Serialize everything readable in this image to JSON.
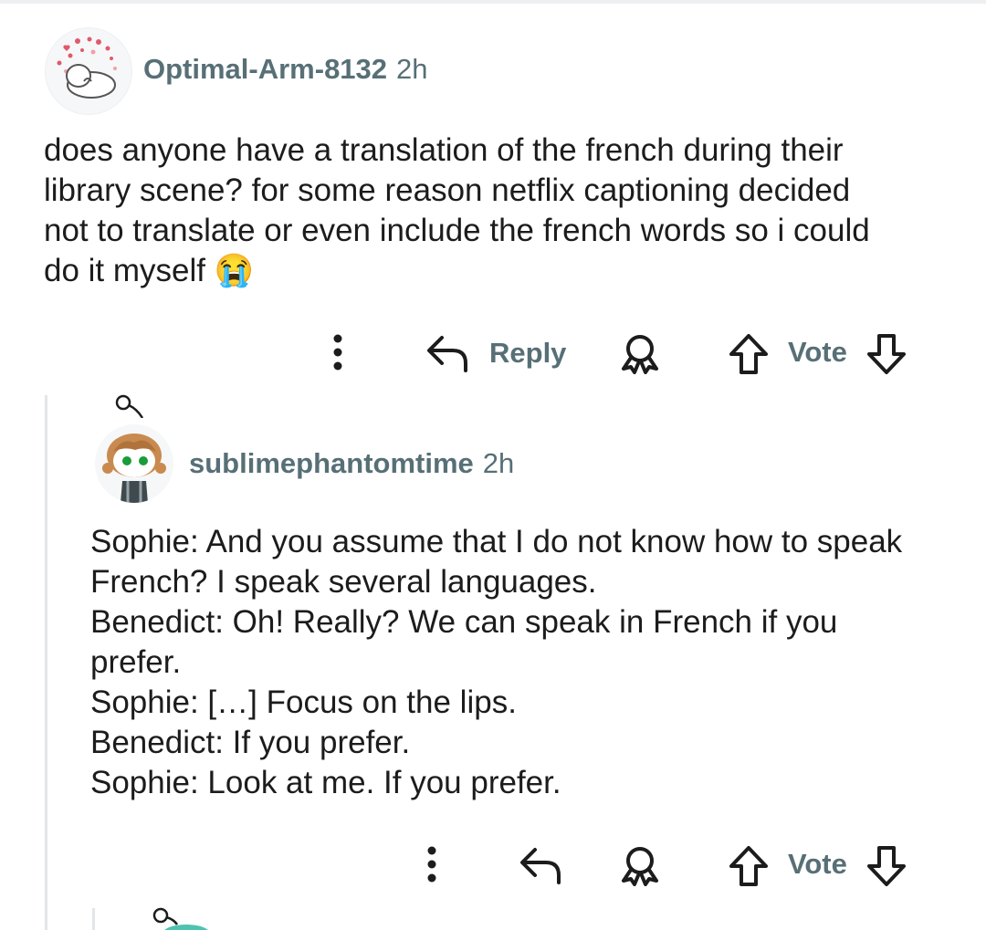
{
  "comments": [
    {
      "username": "Optimal-Arm-8132",
      "time": "2h",
      "lines": [
        "does anyone have a translation of the french during their",
        "library scene? for some reason netflix captioning decided",
        "not to translate or even include the french words so i could",
        "do it myself 😭"
      ],
      "reply_label": "Reply",
      "vote_label": "Vote"
    },
    {
      "username": "sublimephantomtime",
      "time": "2h",
      "lines": [
        "Sophie: And you assume that I do not know how to speak",
        "French? I speak several languages.",
        "Benedict: Oh! Really? We can speak in French if you",
        "prefer.",
        "Sophie: […] Focus on the lips.",
        "Benedict: If you prefer.",
        "Sophie: Look at me. If you prefer."
      ],
      "vote_label": "Vote"
    }
  ],
  "colors": {
    "meta": "#576f76",
    "text": "#1c1c1c",
    "thread": "#e3e6e8"
  },
  "icons": [
    "more-options-icon",
    "reply-arrow-icon",
    "award-icon",
    "upvote-icon",
    "downvote-icon"
  ]
}
